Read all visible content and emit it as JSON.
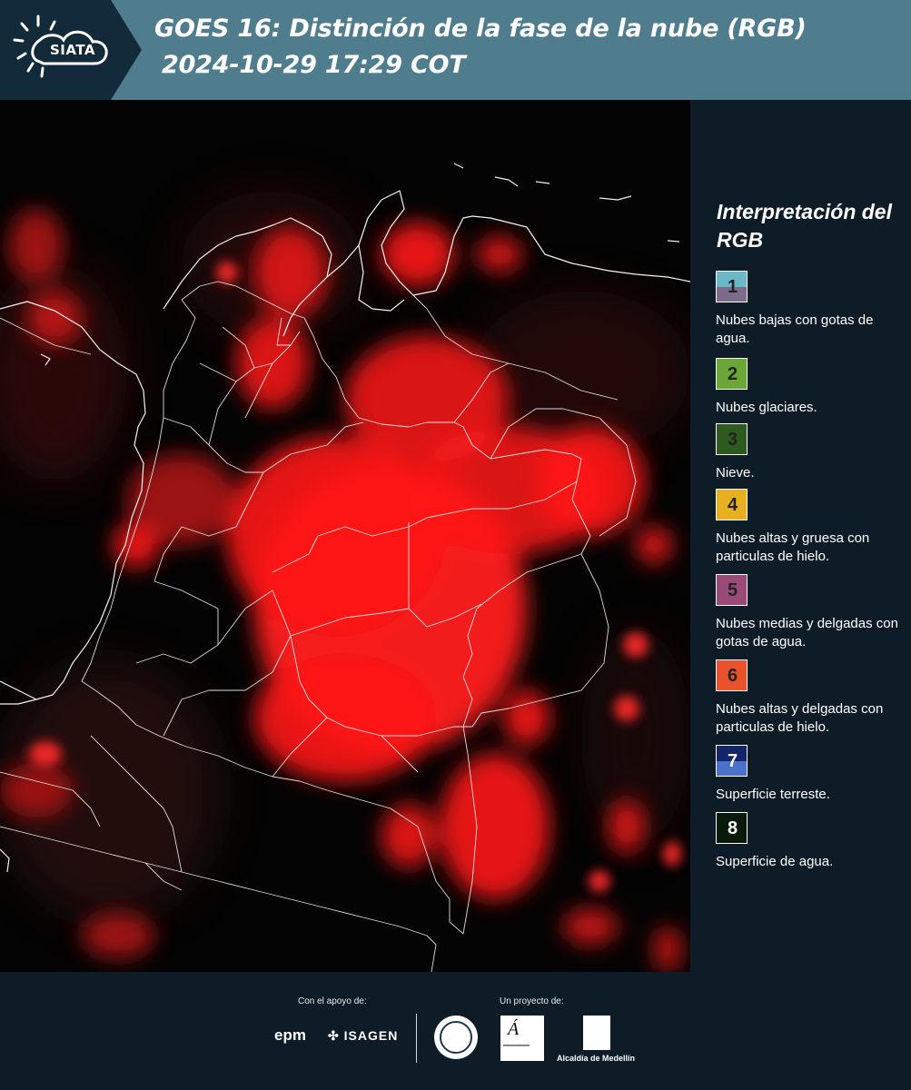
{
  "header": {
    "logo_text": "SIATA",
    "title_line1": "GOES 16: Distinción de la fase de la nube (RGB)",
    "title_line2": "2024-10-29 17:29 COT"
  },
  "legend": {
    "title": "Interpretación del RGB",
    "items": [
      {
        "number": "1",
        "label": "Nubes bajas con gotas de agua.",
        "color_top": "#6bb9c8",
        "color_bottom": "#7d6b8c"
      },
      {
        "number": "2",
        "label": "Nubes glaciares.",
        "color": "#6aa736"
      },
      {
        "number": "3",
        "label": "Nieve.",
        "color": "#2d5a1f"
      },
      {
        "number": "4",
        "label": "Nubes altas y gruesa con particulas de hielo.",
        "color": "#e6b020"
      },
      {
        "number": "5",
        "label": "Nubes medias y delgadas con gotas de agua.",
        "color": "#9a4a78"
      },
      {
        "number": "6",
        "label": "Nubes altas y delgadas con particulas de hielo.",
        "color": "#e8522c"
      },
      {
        "number": "7",
        "label": "Superficie terreste.",
        "color_top": "#13266b",
        "color_bottom": "#4a72c9"
      },
      {
        "number": "8",
        "label": "Superficie de agua.",
        "color": "#0a1a0a"
      }
    ]
  },
  "footer": {
    "support_label": "Con el apoyo de:",
    "project_label": "Un proyecto de:",
    "epm": "epm",
    "isagen": "ISAGEN",
    "alcaldia": "Alcaldía de Medellín"
  }
}
